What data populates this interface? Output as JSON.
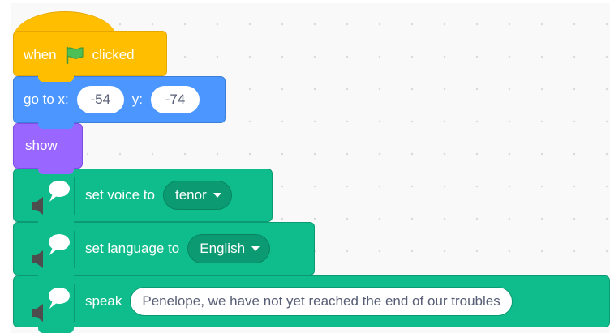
{
  "blocks": {
    "when_flag": {
      "prefix": "when",
      "suffix": "clicked"
    },
    "go_to": {
      "label": "go to x:",
      "x_value": "-54",
      "y_label": "y:",
      "y_value": "-74"
    },
    "show": {
      "label": "show"
    },
    "set_voice": {
      "label": "set voice to",
      "value": "tenor"
    },
    "set_language": {
      "label": "set language to",
      "value": "English"
    },
    "speak": {
      "label": "speak",
      "value": "Penelope, we have not yet reached the end of our troubles"
    }
  },
  "colors": {
    "events": "#ffbf00",
    "motion": "#4c97ff",
    "looks": "#9966ff",
    "text2speech": "#0fbd8c",
    "workspace": "#f9f9f9"
  },
  "icons": {
    "green_flag": "green-flag-icon",
    "text2speech": "text-to-speech-icon",
    "dropdown": "dropdown-caret-icon"
  }
}
